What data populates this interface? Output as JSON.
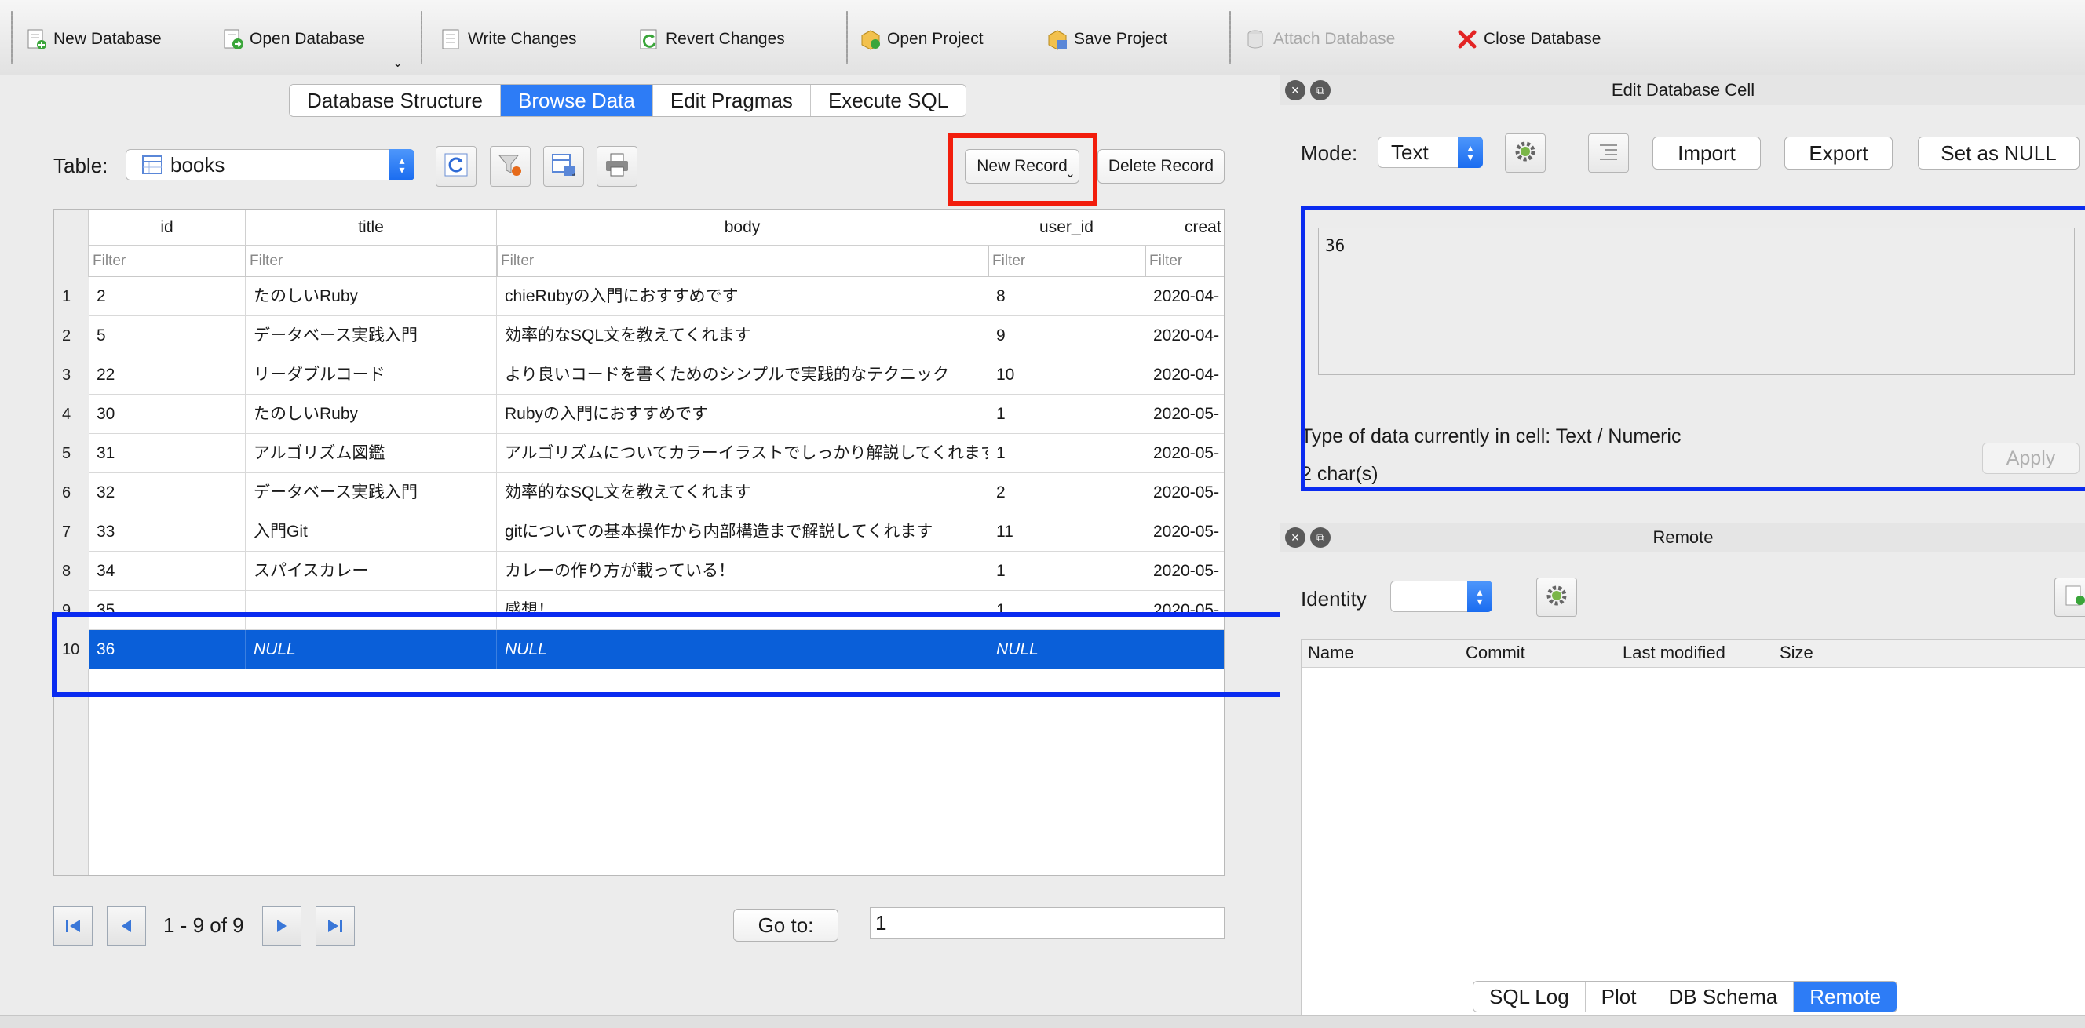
{
  "toolbar": {
    "new_database": "New Database",
    "open_database": "Open Database",
    "write_changes": "Write Changes",
    "revert_changes": "Revert Changes",
    "open_project": "Open Project",
    "save_project": "Save Project",
    "attach_database": "Attach Database",
    "close_database": "Close Database"
  },
  "main_tabs": [
    {
      "label": "Database Structure",
      "active": false
    },
    {
      "label": "Browse Data",
      "active": true
    },
    {
      "label": "Edit Pragmas",
      "active": false
    },
    {
      "label": "Execute SQL",
      "active": false
    }
  ],
  "table_selector": {
    "label": "Table:",
    "value": "books"
  },
  "record_buttons": {
    "new_record": "New Record",
    "delete_record": "Delete Record"
  },
  "grid": {
    "columns": [
      "id",
      "title",
      "body",
      "user_id",
      "creat"
    ],
    "filter_placeholder": "Filter",
    "rows": [
      {
        "n": "1",
        "cells": [
          "2",
          "たのしいRuby",
          "chieRubyの入門におすすめです",
          "8",
          "2020-04-"
        ]
      },
      {
        "n": "2",
        "cells": [
          "5",
          "データベース実践入門",
          "効率的なSQL文を教えてくれます",
          "9",
          "2020-04-"
        ]
      },
      {
        "n": "3",
        "cells": [
          "22",
          "リーダブルコード",
          "より良いコードを書くためのシンプルで実践的なテクニック",
          "10",
          "2020-04-"
        ]
      },
      {
        "n": "4",
        "cells": [
          "30",
          "たのしいRuby",
          "Rubyの入門におすすめです",
          "1",
          "2020-05-"
        ]
      },
      {
        "n": "5",
        "cells": [
          "31",
          "アルゴリズム図鑑",
          "アルゴリズムについてカラーイラストでしっかり解説してくれます",
          "1",
          "2020-05-"
        ]
      },
      {
        "n": "6",
        "cells": [
          "32",
          "データベース実践入門",
          "効率的なSQL文を教えてくれます",
          "2",
          "2020-05-"
        ]
      },
      {
        "n": "7",
        "cells": [
          "33",
          "入門Git",
          "gitについての基本操作から内部構造まで解説してくれます",
          "11",
          "2020-05-"
        ]
      },
      {
        "n": "8",
        "cells": [
          "34",
          "スパイスカレー",
          "カレーの作り方が載っている！",
          "1",
          "2020-05-"
        ]
      },
      {
        "n": "9",
        "cells": [
          "35",
          "",
          "感想！",
          "1",
          "2020-05-"
        ]
      },
      {
        "n": "10",
        "cells": [
          "36",
          "NULL",
          "NULL",
          "NULL",
          ""
        ],
        "selected": true
      }
    ]
  },
  "pagination": {
    "range_text": "1 - 9 of 9",
    "goto_label": "Go to:",
    "goto_value": "1"
  },
  "edit_cell": {
    "title": "Edit Database Cell",
    "mode_label": "Mode:",
    "mode_value": "Text",
    "import": "Import",
    "export": "Export",
    "set_null": "Set as NULL",
    "cell_value": "36",
    "type_text": "Type of data currently in cell: Text / Numeric",
    "size_text": "2 char(s)",
    "apply": "Apply"
  },
  "remote": {
    "title": "Remote",
    "identity_label": "Identity",
    "columns": [
      "Name",
      "Commit",
      "Last modified",
      "Size"
    ]
  },
  "bottom_tabs": [
    {
      "label": "SQL Log",
      "active": false
    },
    {
      "label": "Plot",
      "active": false
    },
    {
      "label": "DB Schema",
      "active": false
    },
    {
      "label": "Remote",
      "active": true
    }
  ],
  "colors": {
    "accent": "#2d7cf6",
    "selection": "#0a5fd9",
    "highlight_blue": "#0a2bf0",
    "highlight_red": "#f21d0c"
  }
}
